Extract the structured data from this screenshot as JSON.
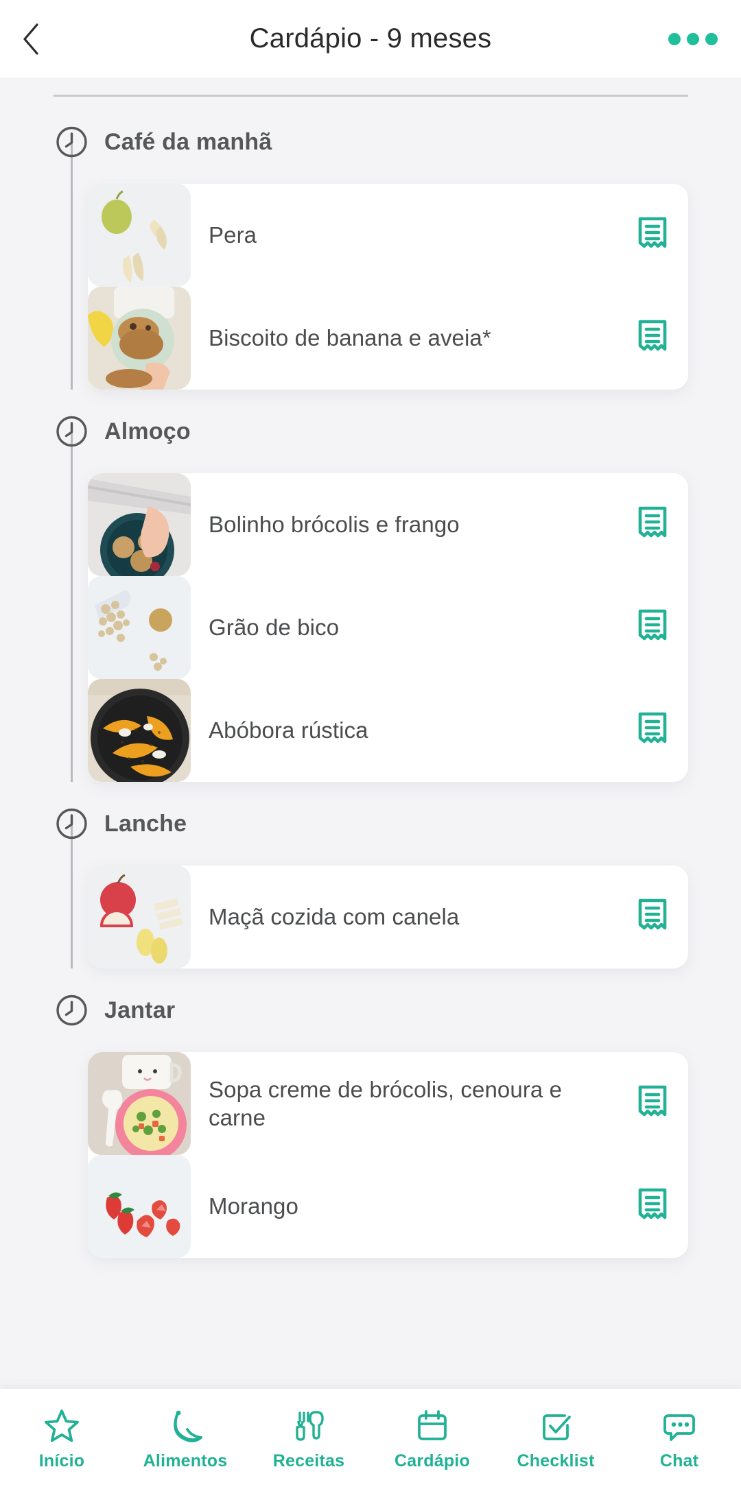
{
  "theme": {
    "accent": "#21b195",
    "accent_dots": "#1fbf9c",
    "background": "#f4f4f6",
    "card": "#ffffff",
    "title_text": "#2b2b2b",
    "section_text": "#555759",
    "item_text": "#4a4c4e",
    "rail": "#b9babe"
  },
  "header": {
    "back_icon": "chevron-left-icon",
    "title": "Cardápio - 9 meses",
    "menu_icon": "more-horizontal-icon"
  },
  "meals": [
    {
      "icon": "clock-icon",
      "title": "Café da manhã",
      "items": [
        {
          "label": "Pera",
          "thumb": "pear-slices-photo",
          "action_icon": "receipt-icon"
        },
        {
          "label": "Biscoito de banana e aveia*",
          "thumb": "banana-oat-cookies-photo",
          "action_icon": "receipt-icon"
        }
      ]
    },
    {
      "icon": "clock-icon",
      "title": "Almoço",
      "items": [
        {
          "label": "Bolinho brócolis e frango",
          "thumb": "broccoli-chicken-balls-photo",
          "action_icon": "receipt-icon"
        },
        {
          "label": "Grão de bico",
          "thumb": "chickpeas-photo",
          "action_icon": "receipt-icon"
        },
        {
          "label": "Abóbora rústica",
          "thumb": "roasted-pumpkin-photo",
          "action_icon": "receipt-icon"
        }
      ]
    },
    {
      "icon": "clock-icon",
      "title": "Lanche",
      "items": [
        {
          "label": "Maçã cozida com canela",
          "thumb": "apple-slices-photo",
          "action_icon": "receipt-icon"
        }
      ]
    },
    {
      "icon": "clock-icon",
      "title": "Jantar",
      "items": [
        {
          "label": "Sopa creme de brócolis, cenoura e carne",
          "thumb": "soup-pink-bowl-photo",
          "action_icon": "receipt-icon"
        },
        {
          "label": "Morango",
          "thumb": "strawberries-photo",
          "action_icon": "receipt-icon"
        }
      ]
    }
  ],
  "bottom_nav": [
    {
      "label": "Início",
      "icon": "star-icon"
    },
    {
      "label": "Alimentos",
      "icon": "banana-icon"
    },
    {
      "label": "Receitas",
      "icon": "fork-spoon-icon"
    },
    {
      "label": "Cardápio",
      "icon": "calendar-icon"
    },
    {
      "label": "Checklist",
      "icon": "checkbox-check-icon"
    },
    {
      "label": "Chat",
      "icon": "chat-bubble-icon"
    }
  ]
}
